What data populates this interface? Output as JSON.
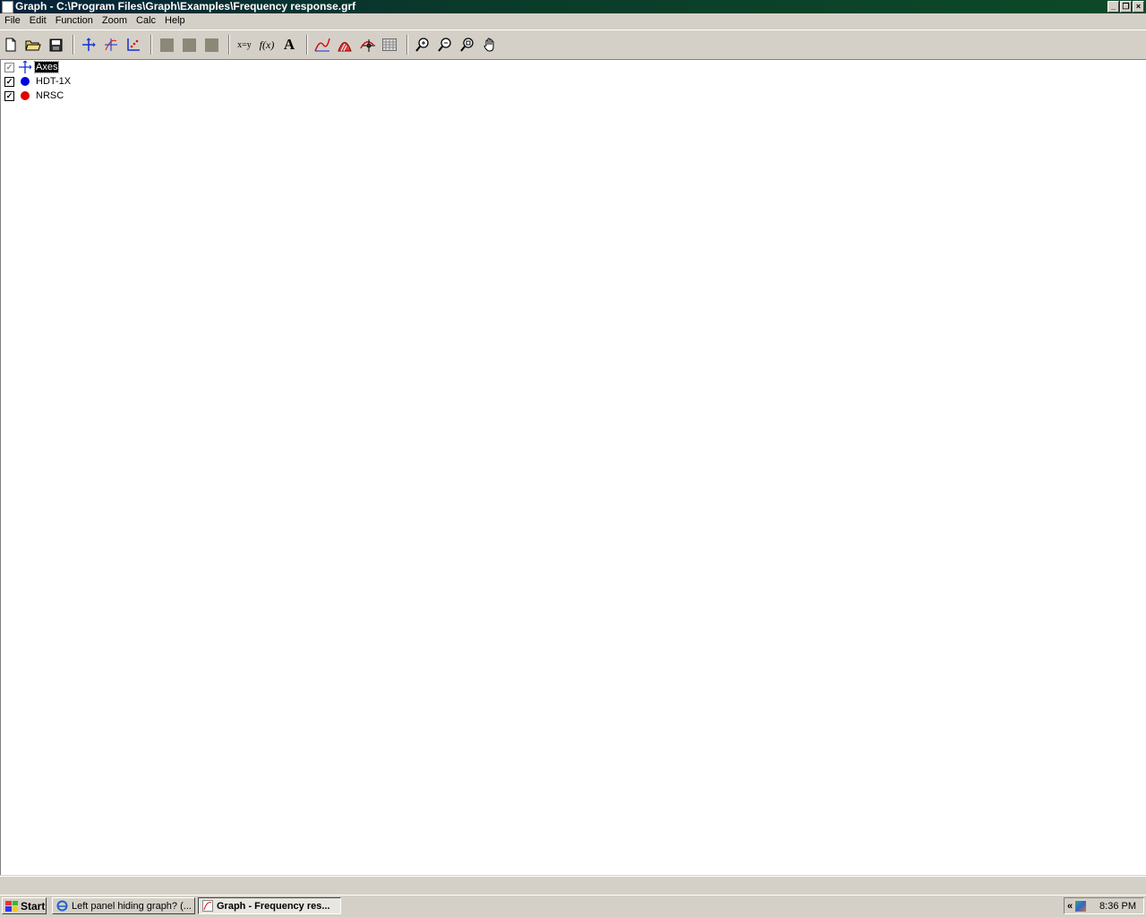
{
  "window": {
    "title": "Graph - C:\\Program Files\\Graph\\Examples\\Frequency response.grf",
    "minimize_glyph": "_",
    "restore_glyph": "❐",
    "close_glyph": "×"
  },
  "menu": [
    "File",
    "Edit",
    "Function",
    "Zoom",
    "Calc",
    "Help"
  ],
  "toolbar": {
    "text_fn_label": "x=y",
    "func_label": "f(x)",
    "text_label": "A"
  },
  "tree": {
    "items": [
      {
        "label": "Axes",
        "checked": true,
        "selected": true,
        "icon": "axes-icon"
      },
      {
        "label": "HDT-1X",
        "checked": true,
        "color": "#0000e0",
        "icon": "blue-dot-icon"
      },
      {
        "label": "NRSC",
        "checked": true,
        "color": "#e00000",
        "icon": "red-dot-icon"
      }
    ]
  },
  "taskbar": {
    "start_label": "Start",
    "tasks": [
      {
        "label": "Left panel hiding graph? (..."
      },
      {
        "label": "Graph - Frequency res..."
      }
    ],
    "tray_chevron": "«",
    "clock": "8:36 PM"
  }
}
